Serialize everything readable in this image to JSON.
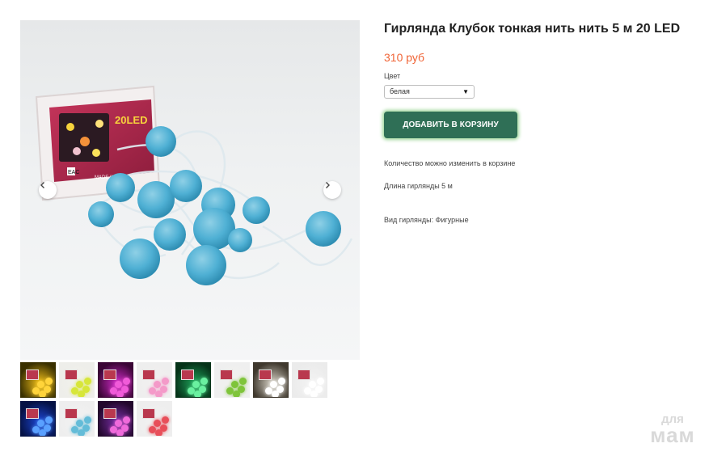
{
  "gallery": {
    "prev_icon": "chevron-left-icon",
    "next_icon": "chevron-right-icon",
    "box_text": "20LED",
    "box_made_in": "MADE IN CHINA",
    "thumbnails": [
      {
        "name": "thumb-yellow",
        "glow": "#f3c11a",
        "ball": "#ffd43b",
        "bg": "#3a3000"
      },
      {
        "name": "thumb-lime",
        "glow": "#f1f1ec",
        "ball": "#d7e63a",
        "bg": "#eeeeea"
      },
      {
        "name": "thumb-magenta",
        "glow": "#d02ac7",
        "ball": "#f15bd9",
        "bg": "#3b0636"
      },
      {
        "name": "thumb-pink",
        "glow": "#f2f0f0",
        "ball": "#f49ac9",
        "bg": "#eeeeee"
      },
      {
        "name": "thumb-green",
        "glow": "#1ea35a",
        "ball": "#6af0a0",
        "bg": "#063319"
      },
      {
        "name": "thumb-green-day",
        "glow": "#f1f1ef",
        "ball": "#7fc43b",
        "bg": "#efefef"
      },
      {
        "name": "thumb-warm-white",
        "glow": "#d9d4c8",
        "ball": "#ffffff",
        "bg": "#40392e"
      },
      {
        "name": "thumb-white",
        "glow": "#f3f3f3",
        "ball": "#ffffff",
        "bg": "#ebebeb"
      },
      {
        "name": "thumb-blue",
        "glow": "#1d46d6",
        "ball": "#5aa0ff",
        "bg": "#051245"
      },
      {
        "name": "thumb-cyan",
        "glow": "#f2f2f2",
        "ball": "#64bcd8",
        "bg": "#eeeeee"
      },
      {
        "name": "thumb-multicolor",
        "glow": "#7a2fa8",
        "ball": "#f06adb",
        "bg": "#23082d"
      },
      {
        "name": "thumb-multicolor-day",
        "glow": "#f1f1f1",
        "ball": "#e84f5a",
        "bg": "#eeeeee"
      }
    ]
  },
  "product": {
    "title": "Гирлянда Клубок тонкая нить нить 5 м 20 LED",
    "price": "310 руб",
    "color_label": "Цвет",
    "color_selected": "белая",
    "dropdown_icon": "caret-down-icon",
    "add_to_cart": "ДОБАВИТЬ В КОРЗИНУ",
    "quantity_note": "Количество можно изменить в корзине",
    "length": "Длина гирлянды 5 м",
    "type": "Вид гирлянды: Фигурные"
  },
  "colors": {
    "price": "#f06436",
    "button": "#2f6f56",
    "button_glow": "#9fd79a",
    "ball": "#5db3d2"
  },
  "watermark": {
    "line1": "для",
    "line2": "мам"
  }
}
